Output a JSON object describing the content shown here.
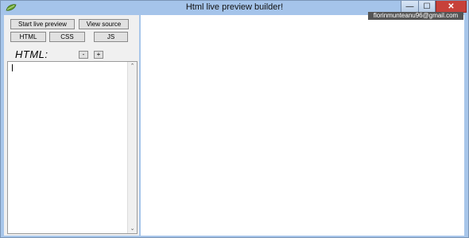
{
  "window": {
    "title": "Html live preview builder!",
    "minimize_glyph": "—",
    "maximize_glyph": "☐",
    "close_glyph": "✕",
    "app_icon": "leaf-icon"
  },
  "user": {
    "email": "florinmunteanu96@gmail.com"
  },
  "toolbar": {
    "start_live_preview": "Start live preview",
    "view_source": "View source",
    "html_tab": "HTML",
    "css_tab": "CSS",
    "js_tab": "JS"
  },
  "editor": {
    "label": "HTML:",
    "decrease_label": "-",
    "increase_label": "+",
    "content": ""
  },
  "scrollbar": {
    "up_glyph": "⌃",
    "down_glyph": "⌄"
  },
  "colors": {
    "title_bar": "#a5c4ea",
    "close_button": "#c7413a",
    "panel": "#f0f0f0",
    "preview": "#ffffff"
  }
}
